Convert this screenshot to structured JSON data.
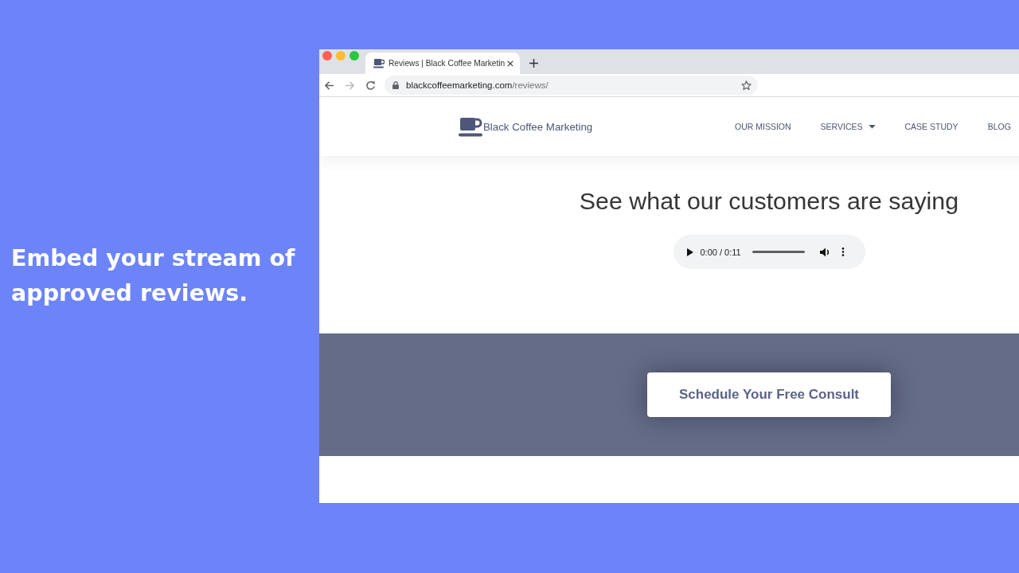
{
  "headline": "Embed your stream of approved reviews.",
  "browser": {
    "window_controls": [
      {
        "kind": "close"
      },
      {
        "kind": "minimize"
      },
      {
        "kind": "maximize"
      }
    ],
    "tabs": [
      {
        "title": "Reviews | Black Coffee Marketin",
        "selected": true
      }
    ],
    "nav_buttons": [
      {
        "kind": "back",
        "disabled": false
      },
      {
        "kind": "forward",
        "disabled": true
      },
      {
        "kind": "reload",
        "disabled": false
      }
    ],
    "address": {
      "domain": "blackcoffeemarketing.com",
      "path": "/reviews/"
    }
  },
  "site": {
    "brand": "Black Coffee Marketing",
    "nav": [
      {
        "label": "OUR MISSION",
        "dropdown": false
      },
      {
        "label": "SERVICES",
        "dropdown": true
      },
      {
        "label": "CASE STUDY",
        "dropdown": false
      },
      {
        "label": "BLOG",
        "dropdown": false
      }
    ],
    "heading": "See what our customers are saying",
    "audio": {
      "time": "0:00 / 0:11"
    },
    "cta": "Schedule Your Free Consult"
  }
}
